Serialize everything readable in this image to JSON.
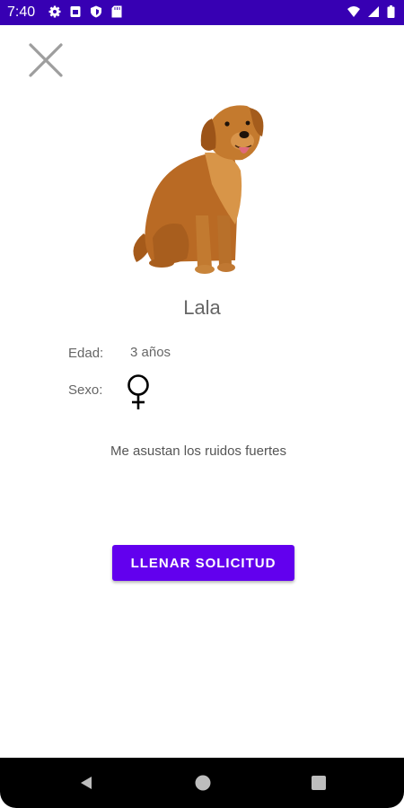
{
  "status_bar": {
    "time": "7:40",
    "left_icons": [
      "settings-icon",
      "sim-card-icon",
      "shield-icon",
      "sd-card-icon"
    ],
    "right_icons": [
      "wifi-icon",
      "signal-icon",
      "battery-icon"
    ],
    "background_color": "#3700b3"
  },
  "header": {
    "close_icon": "close-icon"
  },
  "pet": {
    "name": "Lala",
    "age_label": "Edad:",
    "age_value": "3 años",
    "sex_label": "Sexo:",
    "sex_icon": "female-symbol-icon",
    "description": "Me asustan los ruidos fuertes"
  },
  "action": {
    "button_label": "LLENAR SOLICITUD",
    "button_color": "#6200ee"
  },
  "nav_bar": {
    "icons": [
      "back-icon",
      "home-icon",
      "recents-icon"
    ]
  }
}
